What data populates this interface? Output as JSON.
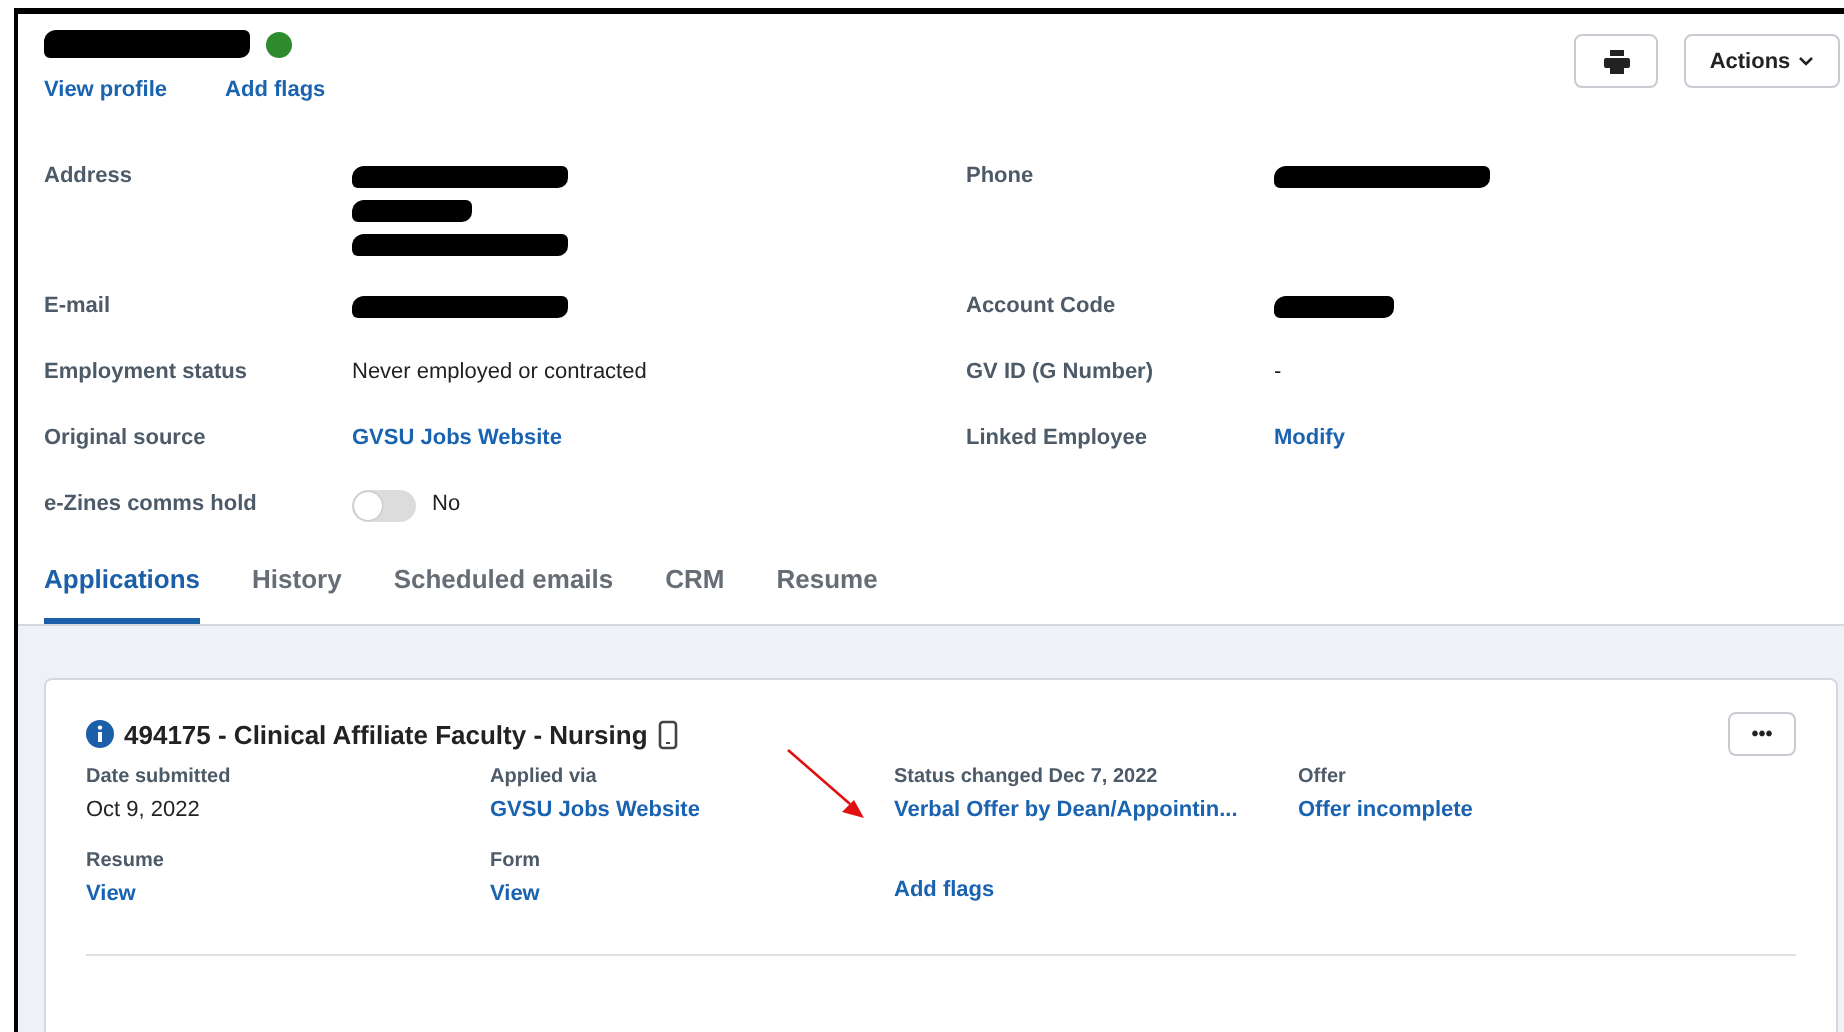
{
  "profile": {
    "name_redacted": true,
    "status_dot": {
      "color": "#2e8b2e"
    },
    "links": [
      "View profile",
      "Add flags"
    ]
  },
  "header_buttons": [
    {
      "kind": "print"
    },
    {
      "kind": "menu",
      "label": "Actions"
    }
  ],
  "fields": [
    {
      "label": "Address",
      "kind": "redacted",
      "redactions": [
        {
          "wide": true
        },
        {
          "wide": false
        },
        {
          "wide": true
        }
      ]
    },
    {
      "label": "Phone",
      "kind": "redacted",
      "redactions": [
        {
          "wide": true
        }
      ]
    },
    {
      "label": "E-mail",
      "kind": "redacted",
      "redactions": [
        {
          "wide": true
        }
      ]
    },
    {
      "label": "Account Code",
      "kind": "redacted",
      "redactions": [
        {
          "wide": false
        }
      ]
    },
    {
      "label": "Employment status",
      "kind": "text",
      "value": "Never employed or contracted"
    },
    {
      "label": "GV ID (G Number)",
      "kind": "text",
      "value": "-"
    },
    {
      "label": "Original source",
      "kind": "link",
      "value": "GVSU Jobs Website"
    },
    {
      "label": "Linked Employee",
      "kind": "link",
      "value": "Modify"
    },
    {
      "label": "e-Zines comms hold",
      "kind": "toggle",
      "on": false,
      "value": "No"
    }
  ],
  "tabs": [
    {
      "label": "Applications",
      "selected": true
    },
    {
      "label": "History",
      "selected": false
    },
    {
      "label": "Scheduled emails",
      "selected": false
    },
    {
      "label": "CRM",
      "selected": false
    },
    {
      "label": "Resume",
      "selected": false
    }
  ],
  "application": {
    "title": "494175 - Clinical Affiliate Faculty - Nursing",
    "more_button": "•••",
    "fields": [
      {
        "label": "Date submitted",
        "kind": "text",
        "value": "Oct 9, 2022"
      },
      {
        "label": "Applied via",
        "kind": "link",
        "value": "GVSU Jobs Website"
      },
      {
        "label": "Status changed Dec 7, 2022",
        "kind": "link",
        "value": "Verbal Offer by Dean/Appointin..."
      },
      {
        "label": "Offer",
        "kind": "link",
        "value": "Offer incomplete"
      },
      {
        "label": "Resume",
        "kind": "link",
        "value": "View"
      },
      {
        "label": "Form",
        "kind": "link",
        "value": "View"
      },
      {
        "kind": "link",
        "value": "Add flags"
      }
    ]
  }
}
